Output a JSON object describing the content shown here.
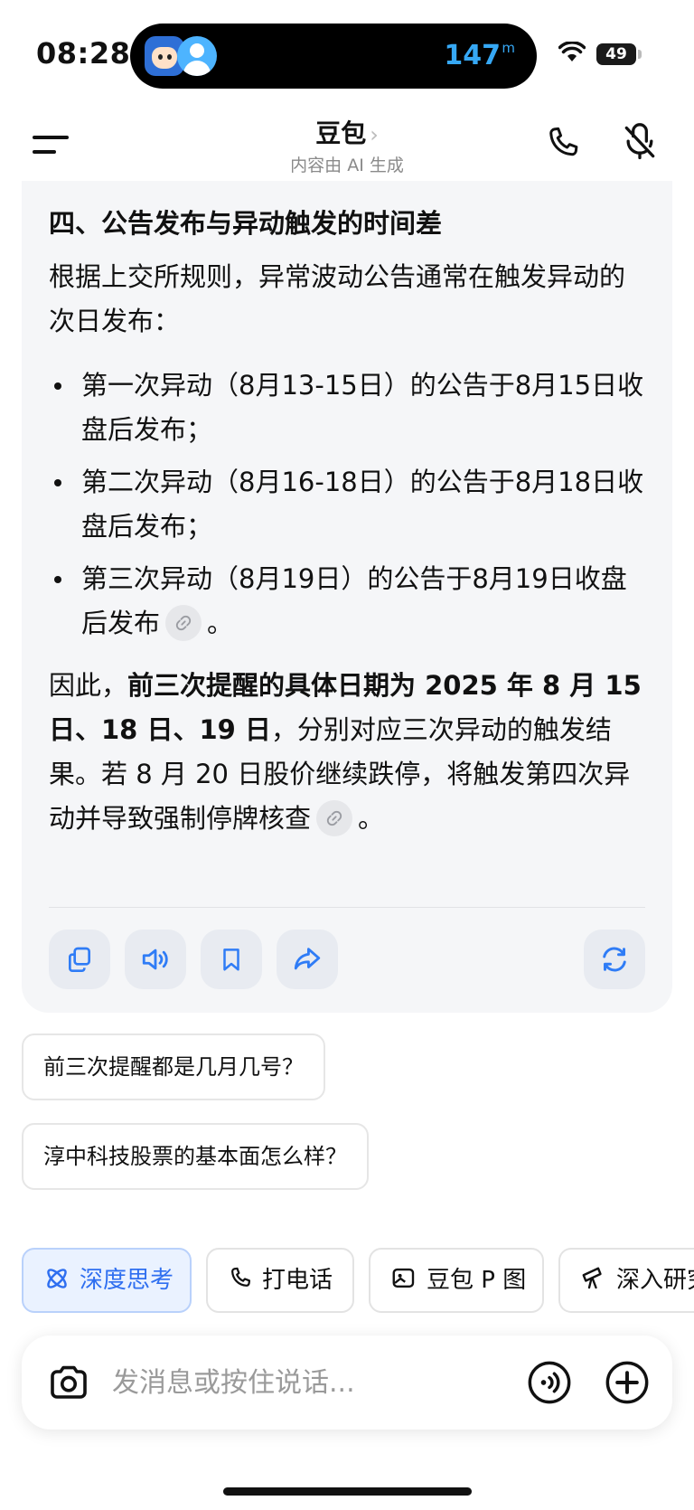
{
  "status": {
    "time": "08:28",
    "island_value": "147",
    "island_unit": "m",
    "battery": "49"
  },
  "nav": {
    "title": "豆包",
    "chevron": "›",
    "subtitle": "内容由 AI 生成"
  },
  "answer": {
    "heading": "四、公告发布与异动触发的时间差",
    "intro": "根据上交所规则，异常波动公告通常在触发异动的次日发布：",
    "bullets": [
      "第一次异动（8月13-15日）的公告于8月15日收盘后发布；",
      "第二次异动（8月16-18日）的公告于8月18日收盘后发布；",
      "第三次异动（8月19日）的公告于8月19日收盘后发布"
    ],
    "bullet3_end": "。",
    "conclusion_prefix": "因此，",
    "conclusion_bold": "前三次提醒的具体日期为 2025 年 8 月 15 日、18 日、19 日",
    "conclusion_rest": "，分别对应三次异动的触发结果。若 8 月 20 日股价继续跌停，将触发第四次异动并导致强制停牌核查",
    "conclusion_end": "。"
  },
  "suggestions": [
    "前三次提醒都是几月几号？",
    "淳中科技股票的基本面怎么样？"
  ],
  "chips": [
    "深度思考",
    "打电话",
    "豆包 P 图",
    "深入研究"
  ],
  "input": {
    "placeholder": "发消息或按住说话..."
  },
  "colors": {
    "accent": "#2f6ff0",
    "card_bg": "#f5f6f8",
    "action_icon": "#2f7cf6"
  }
}
